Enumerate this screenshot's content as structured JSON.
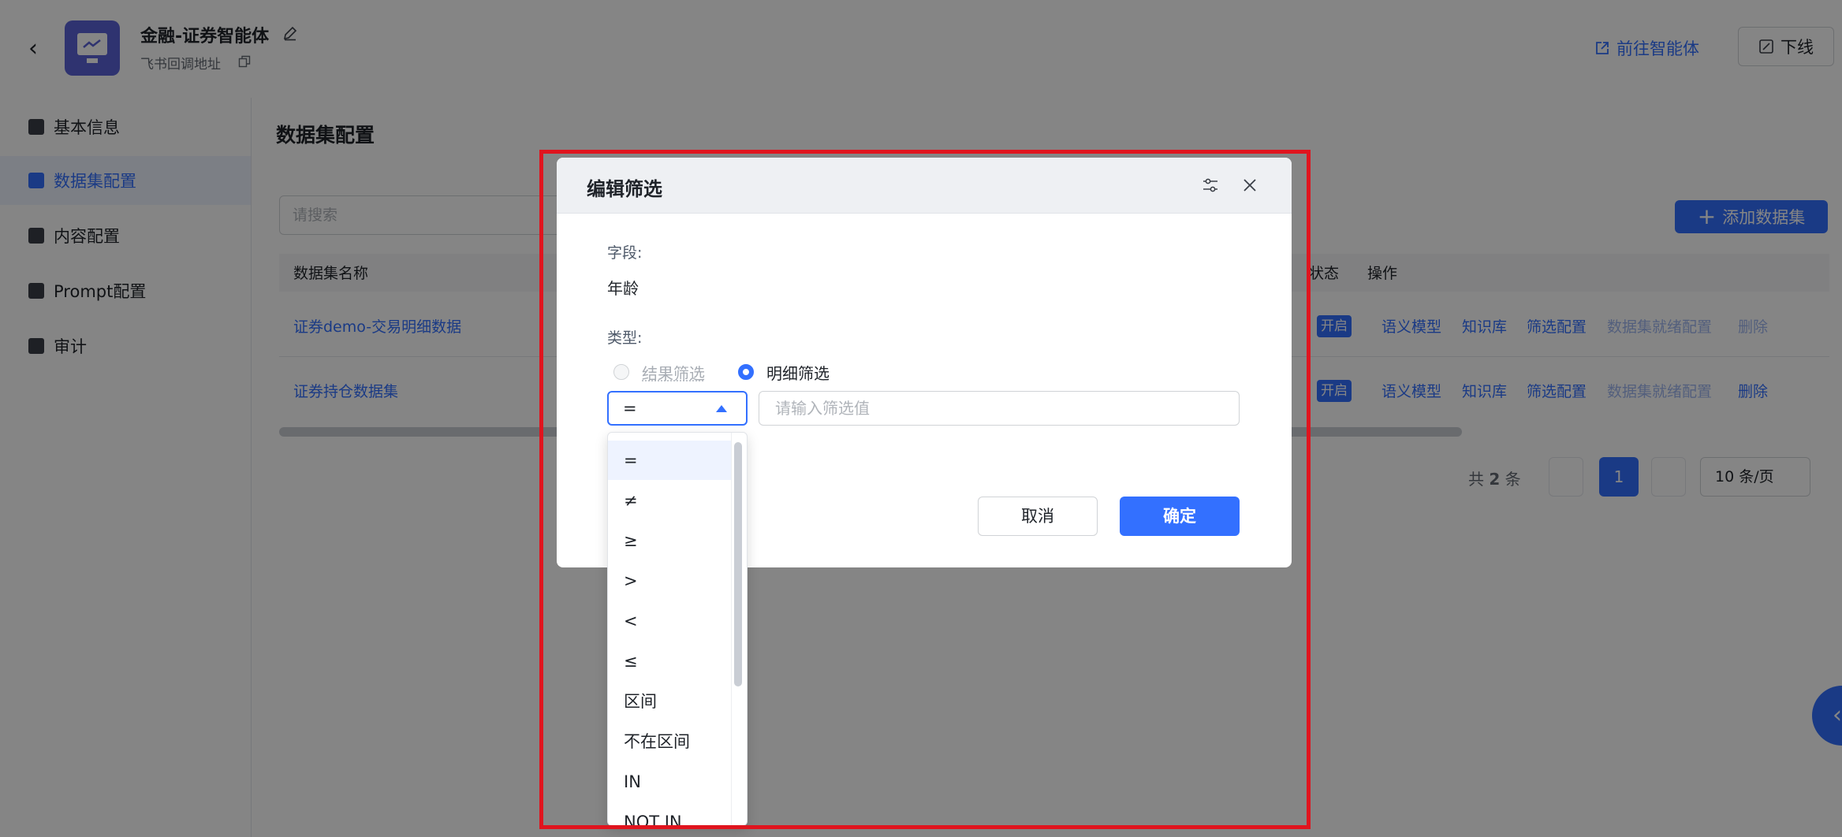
{
  "header": {
    "agent_title": "金融-证券智能体",
    "callback_label": "飞书回调地址",
    "goto_agent_label": "前往智能体",
    "offline_label": "下线"
  },
  "sidebar": {
    "items": [
      {
        "label": "基本信息"
      },
      {
        "label": "数据集配置"
      },
      {
        "label": "内容配置"
      },
      {
        "label": "Prompt配置"
      },
      {
        "label": "审计"
      }
    ]
  },
  "main": {
    "title": "数据集配置",
    "search_placeholder": "请搜索",
    "add_dataset_label": "添加数据集",
    "columns": {
      "name": "数据集名称",
      "status": "状态",
      "actions": "操作"
    },
    "rows": [
      {
        "name": "证券demo-交易明细数据",
        "status": "开启"
      },
      {
        "name": "证券持仓数据集",
        "status": "开启"
      }
    ],
    "row_actions": [
      "语义模型",
      "知识库",
      "筛选配置",
      "数据集就绪配置",
      "删除"
    ],
    "pagination": {
      "total_prefix": "共",
      "total": "2",
      "total_suffix": "条",
      "current_page": "1",
      "page_size": "10 条/页"
    }
  },
  "dialog": {
    "title": "编辑筛选",
    "field_label": "字段:",
    "field_value": "年龄",
    "type_label": "类型:",
    "type_options": [
      {
        "label": "结果筛选",
        "selected": false,
        "disabled": true
      },
      {
        "label": "明细筛选",
        "selected": true,
        "disabled": false
      }
    ],
    "operator_value": "=",
    "value_placeholder": "请输入筛选值",
    "cancel_label": "取消",
    "confirm_label": "确定"
  },
  "dropdown": {
    "options": [
      "=",
      "≠",
      "≥",
      ">",
      "<",
      "≤",
      "区间",
      "不在区间",
      "IN",
      "NOT IN"
    ],
    "selected_index": 0
  },
  "colors": {
    "primary": "#3370ff",
    "highlight_border": "#e0141e",
    "overlay": "rgba(0,0,0,0.48)"
  }
}
